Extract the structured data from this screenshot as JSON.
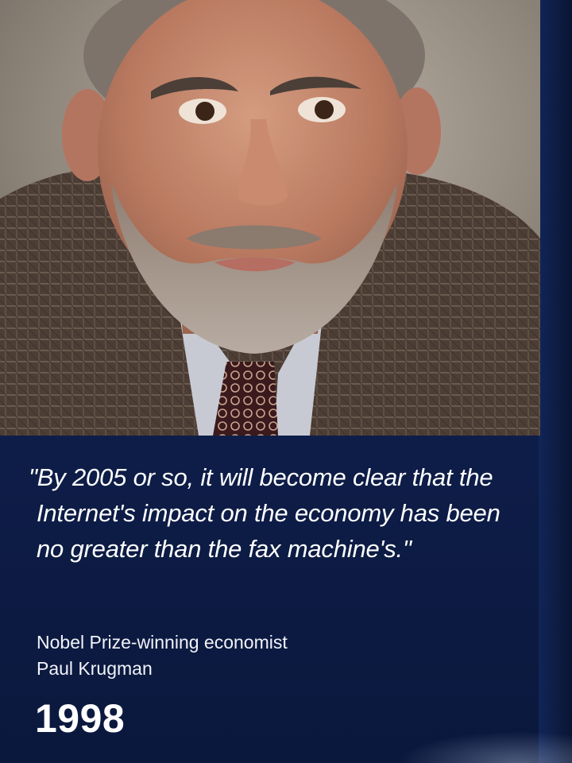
{
  "photo": {
    "subject": "portrait-of-bearded-man-in-plaid-jacket",
    "colors": {
      "background": "#8d8378",
      "jacket": "#4e3f36",
      "shirt": "#c7c9d2",
      "tie": "#3a1a1c",
      "skin": "#c28a70",
      "beard": "#9a8c80"
    }
  },
  "quote": "\"By 2005 or so, it will become clear that the Internet's impact on the economy has been no greater than the fax machine's.\"",
  "attribution": {
    "line1": "Nobel Prize-winning economist",
    "line2": "Paul Krugman"
  },
  "year": "1998",
  "colors": {
    "panel_background": "#13265a",
    "text": "#ffffff"
  }
}
